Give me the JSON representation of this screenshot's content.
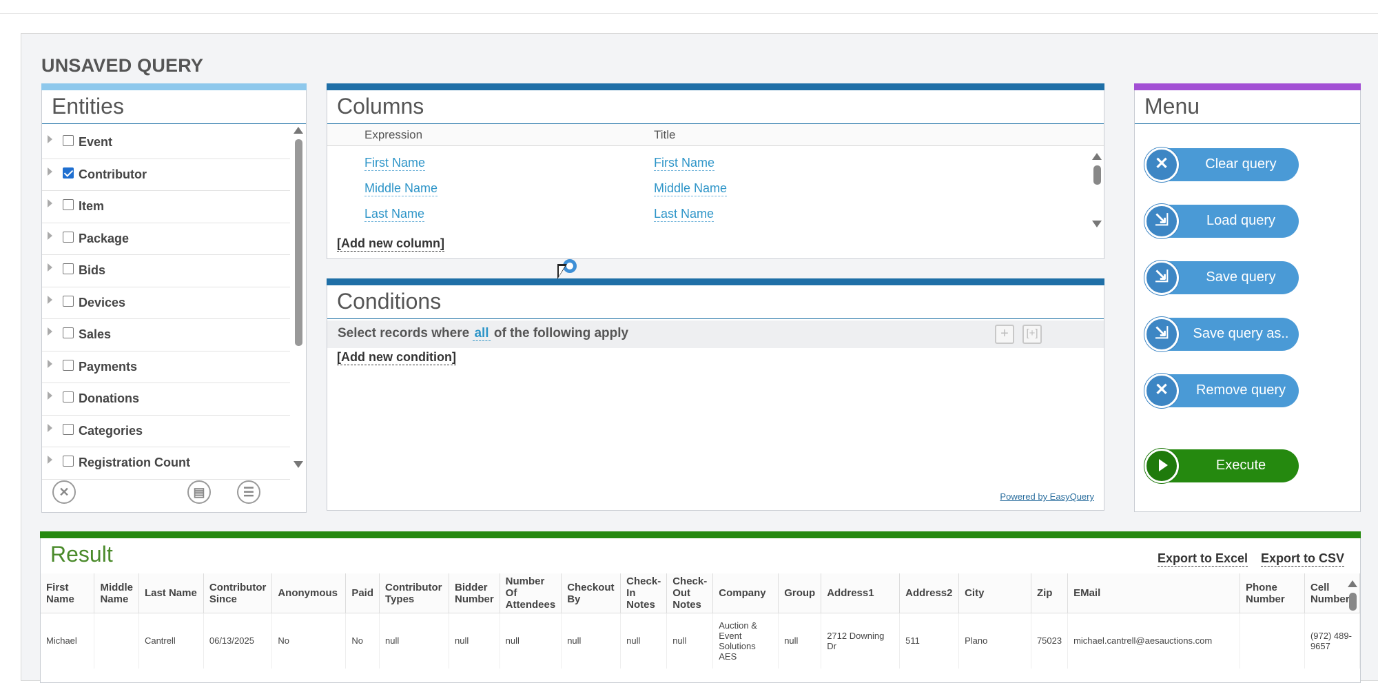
{
  "page_title": "UNSAVED QUERY",
  "entities": {
    "title": "Entities",
    "items": [
      {
        "label": "Event",
        "checked": false
      },
      {
        "label": "Contributor",
        "checked": true
      },
      {
        "label": "Item",
        "checked": false
      },
      {
        "label": "Package",
        "checked": false
      },
      {
        "label": "Bids",
        "checked": false
      },
      {
        "label": "Devices",
        "checked": false
      },
      {
        "label": "Sales",
        "checked": false
      },
      {
        "label": "Payments",
        "checked": false
      },
      {
        "label": "Donations",
        "checked": false
      },
      {
        "label": "Categories",
        "checked": false
      },
      {
        "label": "Registration Count",
        "checked": false
      }
    ],
    "tools": [
      "clear-icon",
      "table-icon",
      "list-icon"
    ]
  },
  "columns": {
    "title": "Columns",
    "header_expression": "Expression",
    "header_title": "Title",
    "rows": [
      {
        "expression": "First Name",
        "title": "First Name"
      },
      {
        "expression": "Middle Name",
        "title": "Middle Name"
      },
      {
        "expression": "Last Name",
        "title": "Last Name"
      }
    ],
    "add_label": "[Add new column]"
  },
  "conditions": {
    "title": "Conditions",
    "prefix": "Select records where",
    "mode": "all",
    "suffix": "of the following apply",
    "add_btn": "+",
    "group_btn": "[+]",
    "add_label": "[Add new condition]",
    "powered": "Powered by EasyQuery"
  },
  "menu": {
    "title": "Menu",
    "buttons": [
      {
        "label": "Clear query",
        "icon": "x-icon",
        "glyph": "✕"
      },
      {
        "label": "Load query",
        "icon": "load-icon",
        "glyph": "⇲"
      },
      {
        "label": "Save query",
        "icon": "save-icon",
        "glyph": "⇲"
      },
      {
        "label": "Save query as..",
        "icon": "save-as-icon",
        "glyph": "⇲"
      },
      {
        "label": "Remove query",
        "icon": "x-icon",
        "glyph": "✕"
      }
    ],
    "execute": "Execute",
    "colors": {
      "button": "#4a9ad6",
      "execute": "#25890f",
      "accent": "#a24fd4"
    }
  },
  "result": {
    "title": "Result",
    "export_excel": "Export to Excel",
    "export_csv": "Export to CSV",
    "columns": [
      "First Name",
      "Middle Name",
      "Last Name",
      "Contributor Since",
      "Anonymous",
      "Paid",
      "Contributor Types",
      "Bidder Number",
      "Number Of Attendees",
      "Checkout By",
      "Check-In Notes",
      "Check-Out Notes",
      "Company",
      "Group",
      "Address1",
      "Address2",
      "City",
      "Zip",
      "EMail",
      "Phone Number",
      "Cell Number"
    ],
    "rows": [
      [
        "Michael",
        "",
        "Cantrell",
        "06/13/2025",
        "No",
        "No",
        "null",
        "null",
        "null",
        "null",
        "null",
        "null",
        "Auction & Event Solutions AES",
        "null",
        "2712 Downing Dr",
        "511",
        "Plano",
        "75023",
        "michael.cantrell@aesauctions.com",
        "",
        "(972) 489-9657"
      ]
    ]
  }
}
